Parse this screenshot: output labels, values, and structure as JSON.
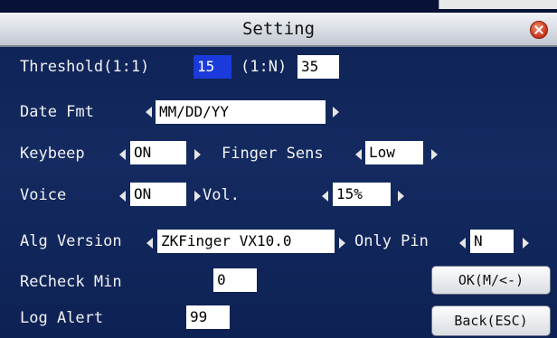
{
  "window": {
    "title": "Setting"
  },
  "fields": {
    "threshold_11": {
      "label": "Threshold(1:1)",
      "value": "15"
    },
    "threshold_1n": {
      "label": "(1:N)",
      "value": "35"
    },
    "date_fmt": {
      "label": "Date Fmt",
      "value": "MM/DD/YY"
    },
    "keybeep": {
      "label": "Keybeep",
      "value": "ON"
    },
    "finger_sens": {
      "label": "Finger Sens",
      "value": "Low"
    },
    "voice": {
      "label": "Voice",
      "value": "ON"
    },
    "vol": {
      "label": "Vol.",
      "value": "15%"
    },
    "alg_version": {
      "label": "Alg Version",
      "value": "ZKFinger VX10.0"
    },
    "only_pin": {
      "label": "Only Pin",
      "value": "N"
    },
    "recheck_min": {
      "label": "ReCheck Min",
      "value": "0"
    },
    "log_alert": {
      "label": "Log Alert",
      "value": "99"
    }
  },
  "buttons": {
    "ok": "OK(M/<-)",
    "back": "Back(ESC)"
  },
  "colors": {
    "background": "#0a1d4a",
    "selection": "#1a3adb",
    "close": "#c8331a"
  },
  "icons": {
    "close": "close-icon",
    "left": "arrow-left-icon",
    "right": "arrow-right-icon"
  }
}
